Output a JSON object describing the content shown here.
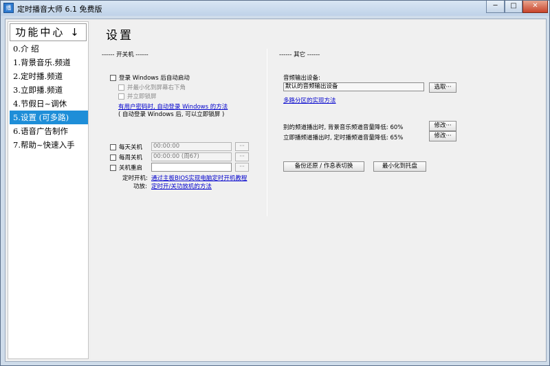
{
  "window": {
    "title": "定时播音大师 6.1 免费版",
    "icon": "app-icon",
    "controls": {
      "minimize": "─",
      "maximize": "□",
      "close": "✕"
    }
  },
  "sidebar": {
    "title": "功能中心",
    "title_arrow": "↓",
    "items": [
      {
        "label": "0.介 绍"
      },
      {
        "label": "1.背景音乐.频道"
      },
      {
        "label": "2.定时播.频道"
      },
      {
        "label": "3.立即播.频道"
      },
      {
        "label": "4.节假日~调休"
      },
      {
        "label": "5.设置 (可多路)",
        "selected": true
      },
      {
        "label": "6.语音广告制作"
      },
      {
        "label": "7.帮助~快速入手"
      }
    ]
  },
  "main": {
    "title": "设置"
  },
  "power": {
    "group_label": "------ 开关机 ------",
    "autologin": {
      "label": "登录 Windows 后自动启动",
      "checked": false
    },
    "minimize": {
      "label": "并最小化到屏幕右下角",
      "checked": false
    },
    "lock": {
      "label": "并立即锁屏",
      "checked": false
    },
    "autologin_link": "有用户密码时, 自动登录 Windows 的方法",
    "autologin_note": "( 自动登录 Windows 后, 可以立即锁屏 )",
    "daily_shutdown": {
      "label": "每天关机",
      "value": "00:00:00",
      "button": "···",
      "checked": false
    },
    "weekly_shutdown": {
      "label": "每周关机",
      "value": "00:00:00 (周67)",
      "button": "···",
      "checked": false
    },
    "restart": {
      "label": "关机重启",
      "value": "",
      "button": "···",
      "checked": false
    },
    "boot_label": "定时开机:",
    "boot_link": "通过主板BIOS实现电脑定时开机教程",
    "func_label": "功放:",
    "func_link": "定时开/关功放机的方法"
  },
  "other": {
    "group_label": "------ 其它 ------",
    "audio_label": "音频输出设备:",
    "audio_value": "默认的音频输出设备",
    "select_button": "选取···",
    "multi_link": "多路分区的实现方法",
    "row1_label": "别的频道播出时, 背景音乐频道音量降低: 60%",
    "row1_button": "修改···",
    "row2_label": "立即播频道播出时, 定时播频道音量降低: 65%",
    "row2_button": "修改···",
    "backup_button": "备份还原 / 作息表切换",
    "tray_button": "最小化到托盘"
  }
}
